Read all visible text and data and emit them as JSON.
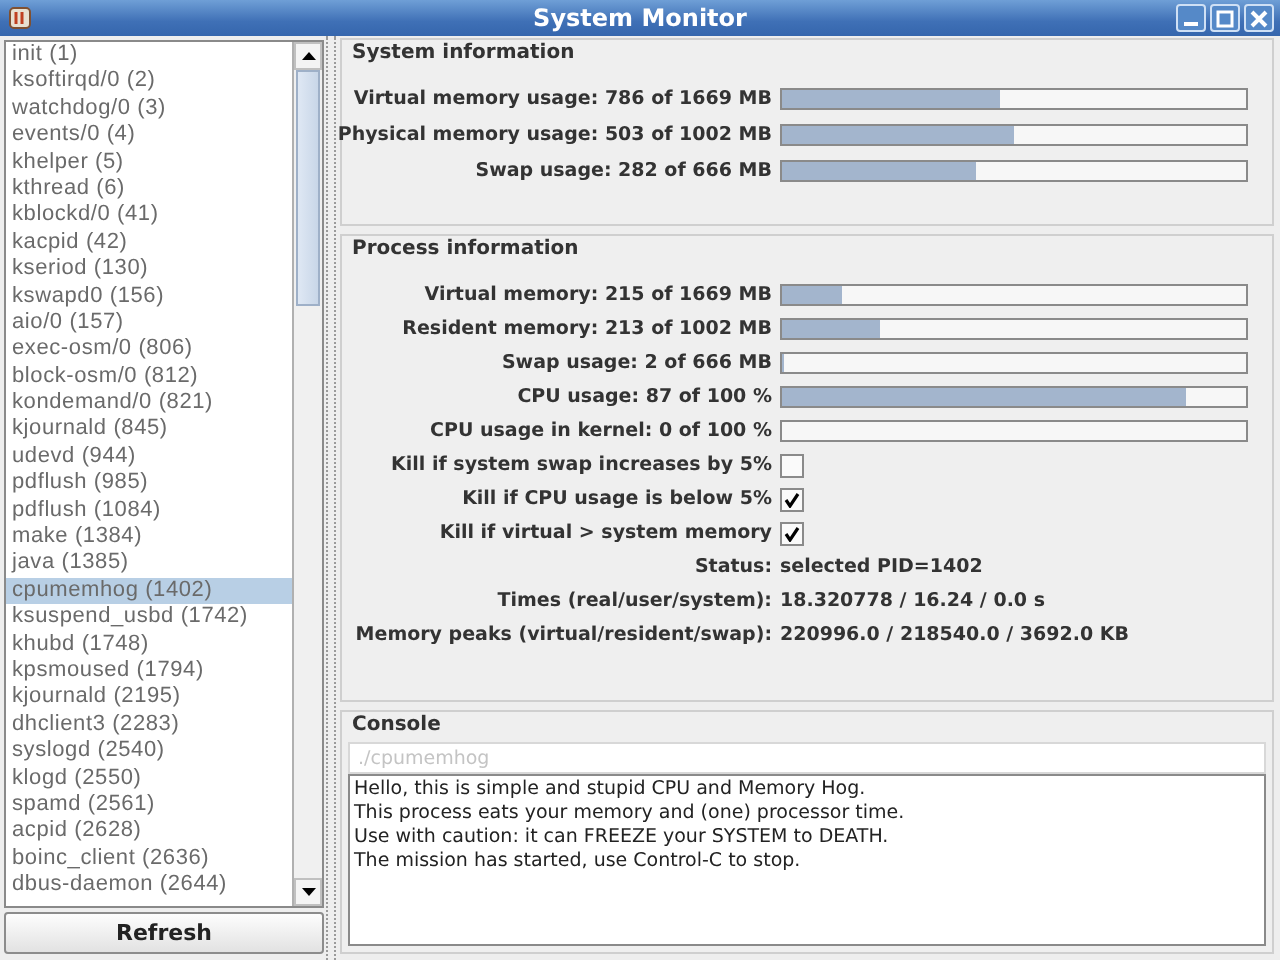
{
  "window": {
    "title": "System Monitor"
  },
  "processes": [
    {
      "label": "init (1)",
      "selected": false
    },
    {
      "label": "ksoftirqd/0 (2)",
      "selected": false
    },
    {
      "label": "watchdog/0 (3)",
      "selected": false
    },
    {
      "label": "events/0 (4)",
      "selected": false
    },
    {
      "label": "khelper (5)",
      "selected": false
    },
    {
      "label": "kthread (6)",
      "selected": false
    },
    {
      "label": "kblockd/0 (41)",
      "selected": false
    },
    {
      "label": "kacpid (42)",
      "selected": false
    },
    {
      "label": "kseriod (130)",
      "selected": false
    },
    {
      "label": "kswapd0 (156)",
      "selected": false
    },
    {
      "label": "aio/0 (157)",
      "selected": false
    },
    {
      "label": "exec-osm/0 (806)",
      "selected": false
    },
    {
      "label": "block-osm/0 (812)",
      "selected": false
    },
    {
      "label": "kondemand/0 (821)",
      "selected": false
    },
    {
      "label": "kjournald (845)",
      "selected": false
    },
    {
      "label": "udevd (944)",
      "selected": false
    },
    {
      "label": "pdflush (985)",
      "selected": false
    },
    {
      "label": "pdflush (1084)",
      "selected": false
    },
    {
      "label": "make (1384)",
      "selected": false
    },
    {
      "label": "java (1385)",
      "selected": false
    },
    {
      "label": "cpumemhog (1402)",
      "selected": true
    },
    {
      "label": "ksuspend_usbd (1742)",
      "selected": false
    },
    {
      "label": "khubd (1748)",
      "selected": false
    },
    {
      "label": "kpsmoused (1794)",
      "selected": false
    },
    {
      "label": "kjournald (2195)",
      "selected": false
    },
    {
      "label": "dhclient3 (2283)",
      "selected": false
    },
    {
      "label": "syslogd (2540)",
      "selected": false
    },
    {
      "label": "klogd (2550)",
      "selected": false
    },
    {
      "label": "spamd (2561)",
      "selected": false
    },
    {
      "label": "acpid (2628)",
      "selected": false
    },
    {
      "label": "boinc_client (2636)",
      "selected": false
    },
    {
      "label": "dbus-daemon (2644)",
      "selected": false
    }
  ],
  "refresh_button": "Refresh",
  "system_information": {
    "title": "System information",
    "rows": [
      {
        "label": "Virtual memory usage: 786 of 1669 MB",
        "level": 0.47
      },
      {
        "label": "Physical memory usage: 503 of 1002 MB",
        "level": 0.5
      },
      {
        "label": "Swap usage: 282 of 666 MB",
        "level": 0.42
      }
    ]
  },
  "process_information": {
    "title": "Process information",
    "rows": [
      {
        "kind": "bar",
        "label": "Virtual memory: 215 of 1669 MB",
        "level": 0.13
      },
      {
        "kind": "bar",
        "label": "Resident memory: 213 of 1002 MB",
        "level": 0.21
      },
      {
        "kind": "bar",
        "label": "Swap usage: 2 of 666 MB",
        "level": 0.003
      },
      {
        "kind": "bar",
        "label": "CPU usage: 87 of 100 %",
        "level": 0.87
      },
      {
        "kind": "bar",
        "label": "CPU usage in kernel: 0 of 100 %",
        "level": 0.0
      },
      {
        "kind": "checkbox",
        "label": "Kill if system swap increases by 5%",
        "checked": false
      },
      {
        "kind": "checkbox",
        "label": "Kill if CPU usage is below 5%",
        "checked": true
      },
      {
        "kind": "checkbox",
        "label": "Kill if virtual > system memory",
        "checked": true
      },
      {
        "kind": "text",
        "label": "Status:",
        "value": "selected PID=1402"
      },
      {
        "kind": "text",
        "label": "Times (real/user/system):",
        "value": "18.320778 / 16.24 / 0.0 s"
      },
      {
        "kind": "text",
        "label": "Memory peaks (virtual/resident/swap):",
        "value": "220996.0 / 218540.0 / 3692.0 KB"
      }
    ]
  },
  "console": {
    "title": "Console",
    "placeholder": "./cpumemhog",
    "lines": [
      "Hello, this is simple and stupid CPU and Memory Hog.",
      "This process eats your memory and (one) processor time.",
      "Use with caution: it can FREEZE your SYSTEM to DEATH.",
      "The mission has started, use Control-C to stop."
    ]
  }
}
